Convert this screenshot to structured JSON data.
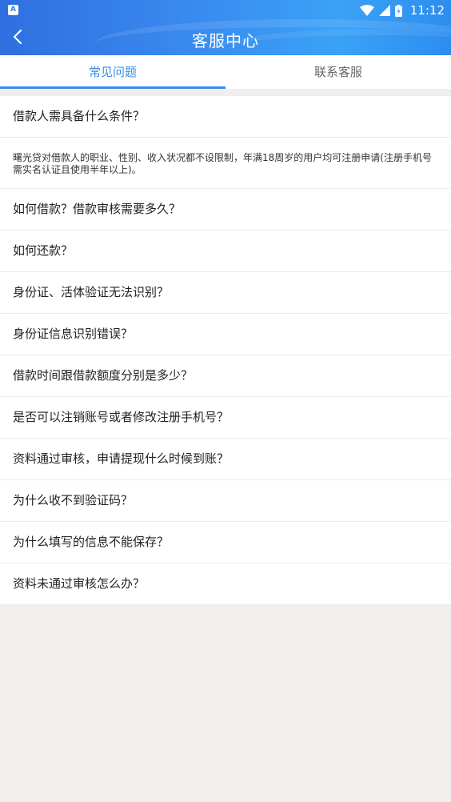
{
  "status_bar": {
    "time": "11:12",
    "icons": [
      "notification-icon",
      "wifi-icon",
      "signal-icon",
      "battery-icon"
    ]
  },
  "header": {
    "title": "客服中心",
    "back_icon": "chevron-left-icon"
  },
  "tabs": [
    {
      "label": "常见问题",
      "active": true
    },
    {
      "label": "联系客服",
      "active": false
    }
  ],
  "faq": {
    "items": [
      {
        "question": "借款人需具备什么条件？"
      },
      {
        "question": "如何借款？借款审核需要多久？"
      },
      {
        "question": "如何还款？"
      },
      {
        "question": "身份证、活体验证无法识别？"
      },
      {
        "question": "身份证信息识别错误？"
      },
      {
        "question": "借款时间跟借款额度分别是多少？"
      },
      {
        "question": "是否可以注销账号或者修改注册手机号？"
      },
      {
        "question": "资料通过审核，申请提现什么时候到账？"
      },
      {
        "question": "为什么收不到验证码？"
      },
      {
        "question": "为什么填写的信息不能保存？"
      },
      {
        "question": "资料未通过审核怎么办？"
      }
    ],
    "expanded_answer": "曙光贷对借款人的职业、性别、收入状况都不设限制，年满18周岁的用户均可注册申请(注册手机号需实名认证且使用半年以上)。"
  },
  "colors": {
    "accent": "#3a8ee6",
    "header_gradient_start": "#2f6fe0",
    "header_gradient_end": "#3aa2f6",
    "background": "#f1efee"
  }
}
